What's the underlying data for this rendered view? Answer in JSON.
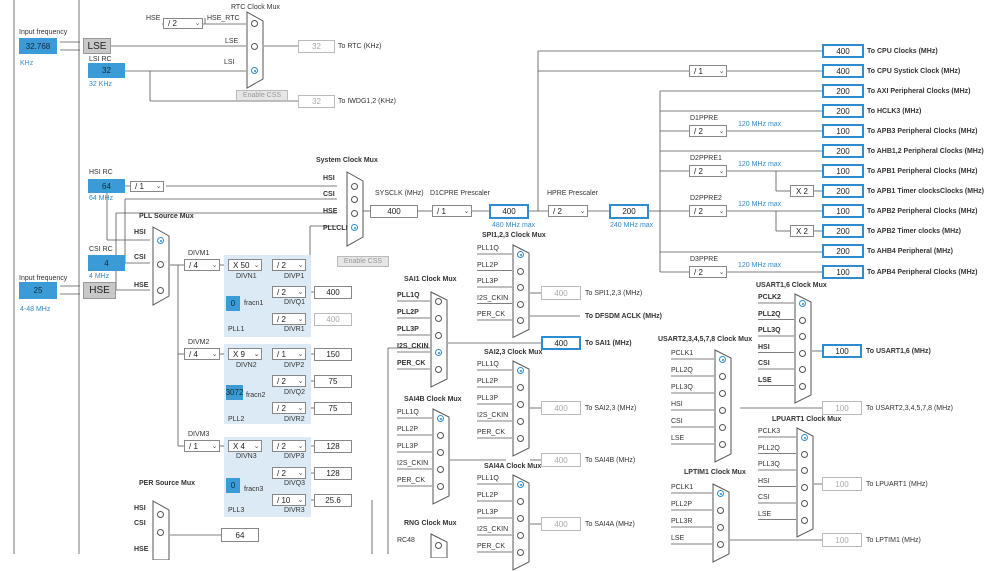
{
  "inputs": {
    "lse_input": {
      "label": "Input frequency",
      "value": "32.768",
      "unit": "KHz"
    },
    "lsi_rc": {
      "label": "LSI RC",
      "value": "32",
      "unit": "32 KHz"
    },
    "hsi_rc": {
      "label": "HSI RC",
      "value": "64",
      "unit": "64 MHz"
    },
    "csi_rc": {
      "label": "CSI RC",
      "value": "4",
      "unit": "4 MHz"
    },
    "hse_input": {
      "label": "Input frequency",
      "value": "25",
      "unit": "4-48 MHz"
    },
    "lse_label": "LSE",
    "hse_label": "HSE"
  },
  "rtc": {
    "mux_title": "RTC Clock Mux",
    "hse_label": "HSE",
    "div_value": "/ 2",
    "hse_rtc_label": "HSE_RTC",
    "lse_label": "LSE",
    "lsi_label": "LSI",
    "rtc_value": "32",
    "rtc_label": "To RTC (KHz)",
    "enable_css": "Enable CSS",
    "iwdg_value": "32",
    "iwdg_label": "To IWDG1,2 (KHz)"
  },
  "sysclk": {
    "mux_title": "System Clock Mux",
    "inputs": [
      "HSI",
      "CSI",
      "HSE",
      "PLLCLK"
    ],
    "sysclk_label": "SYSCLK (MHz)",
    "sysclk_value": "400",
    "d1cpre_label": "D1CPRE Prescaler",
    "d1cpre_value": "/ 1",
    "cpu_value": "400",
    "cpu_max": "480 MHz max",
    "hpre_label": "HPRE Prescaler",
    "hpre_value": "/ 2",
    "axi_value": "200",
    "axi_max": "240 MHz max",
    "enable_css": "Enable CSS"
  },
  "outputs": {
    "systick_div": "/ 1",
    "d1ppre_label": "D1PPRE",
    "d1ppre_value": "/ 2",
    "d1ppre_max": "120 MHz max",
    "d2ppre1_label": "D2PPRE1",
    "d2ppre1_value": "/ 2",
    "d2ppre1_max": "120 MHz max",
    "d2ppre2_label": "D2PPRE2",
    "d2ppre2_value": "/ 2",
    "d2ppre2_max": "120 MHz max",
    "d3ppre_label": "D3PPRE",
    "d3ppre_value": "/ 2",
    "d3ppre_max": "120 MHz max",
    "x2a": "X 2",
    "x2b": "X 2",
    "rows": [
      {
        "value": "400",
        "label": "To CPU Clocks (MHz)"
      },
      {
        "value": "400",
        "label": "To CPU Systick Clock (MHz)"
      },
      {
        "value": "200",
        "label": "To AXI Peripheral Clocks (MHz)"
      },
      {
        "value": "200",
        "label": "To HCLK3 (MHz)"
      },
      {
        "value": "100",
        "label": "To APB3 Peripheral Clocks (MHz)"
      },
      {
        "value": "200",
        "label": "To AHB1,2 Peripheral Clocks (MHz)"
      },
      {
        "value": "100",
        "label": "To APB1 Peripheral Clocks (MHz)"
      },
      {
        "value": "200",
        "label": "To APB1 Timer clocksClocks (MHz)"
      },
      {
        "value": "100",
        "label": "To APB2 Peripheral Clocks (MHz)"
      },
      {
        "value": "200",
        "label": "To APB2 Timer clocks (MHz)"
      },
      {
        "value": "200",
        "label": "To AHB4 Peripheral (MHz)"
      },
      {
        "value": "100",
        "label": "To APB4 Peripheral Clocks (MHz)"
      }
    ]
  },
  "pll": {
    "source_title": "PLL Source Mux",
    "src_hsi": "HSI",
    "src_csi": "CSI",
    "src_hse": "HSE",
    "divm1_label": "DIVM1",
    "divm1_value": "/ 4",
    "divn1_label": "DIVN1",
    "divn1_value": "X 50",
    "divp1_label": "DIVP1",
    "divp1_value": "/ 2",
    "divq1_label": "DIVQ1",
    "divq1_value": "/ 2",
    "q1_out": "400",
    "divr1_label": "DIVR1",
    "divr1_value": "/ 2",
    "r1_out": "400",
    "fracn1_value": "0",
    "fracn1_label": "fracn1",
    "pll1_label": "PLL1",
    "divm2_label": "DIVM2",
    "divm2_value": "/ 4",
    "divn2_label": "DIVN2",
    "divn2_value": "X 9",
    "divp2_label": "DIVP2",
    "divp2_value": "/ 1",
    "p2_out": "150",
    "divq2_label": "DIVQ2",
    "divq2_value": "/ 2",
    "q2_out": "75",
    "divr2_label": "DIVR2",
    "divr2_value": "/ 2",
    "r2_out": "75",
    "fracn2_value": "3072",
    "fracn2_label": "fracn2",
    "pll2_label": "PLL2",
    "divm3_label": "DIVM3",
    "divm3_value": "/ 1",
    "divn3_label": "DIVN3",
    "divn3_value": "X 4",
    "divp3_label": "DIVP3",
    "divp3_value": "/ 2",
    "p3_out": "128",
    "divq3_label": "DIVQ3",
    "divq3_value": "/ 2",
    "q3_out": "128",
    "divr3_label": "DIVR3",
    "divr3_value": "/ 10",
    "r3_out": "25.6",
    "fracn3_value": "0",
    "fracn3_label": "fracn3",
    "pll3_label": "PLL3"
  },
  "per": {
    "title": "PER Source Mux",
    "hsi": "HSI",
    "csi": "CSI",
    "hse": "HSE",
    "value": "64"
  },
  "sai1": {
    "title": "SAI1 Clock Mux",
    "inputs": [
      "PLL1Q",
      "PLL2P",
      "PLL3P",
      "I2S_CKIN",
      "PER_CK"
    ],
    "value": "400",
    "label": "To SAI1 (MHz)"
  },
  "spi123": {
    "title": "SPI1,2,3 Clock Mux",
    "inputs": [
      "PLL1Q",
      "PLL2P",
      "PLL3P",
      "I2S_CKIN",
      "PER_CK"
    ],
    "value": "400",
    "label": "To SPI1,2,3 (MHz)",
    "dfsdm_label": "To DFSDM ACLK (MHz)"
  },
  "sai23": {
    "title": "SAI2,3 Clock Mux",
    "inputs": [
      "PLL1Q",
      "PLL2P",
      "PLL3P",
      "I2S_CKIN",
      "PER_CK"
    ],
    "value": "400",
    "label": "To SAI2,3 (MHz)"
  },
  "sai4b": {
    "title": "SAI4B Clock Mux",
    "inputs": [
      "PLL1Q",
      "PLL2P",
      "PLL3P",
      "I2S_CKIN",
      "PER_CK"
    ],
    "value": "400",
    "label": "To SAI4B (MHz)"
  },
  "sai4a": {
    "title": "SAI4A Clock Mux",
    "inputs": [
      "PLL1Q",
      "PLL2P",
      "PLL3P",
      "I2S_CKIN",
      "PER_CK"
    ],
    "value": "400",
    "label": "To SAI4A (MHz)"
  },
  "rng": {
    "title": "RNG Clock Mux",
    "input0": "RC48"
  },
  "usart16": {
    "title": "USART1,6 Clock Mux",
    "inputs": [
      "PCLK2",
      "PLL2Q",
      "PLL3Q",
      "HSI",
      "CSI",
      "LSE"
    ],
    "value": "100",
    "label": "To USART1,6 (MHz)"
  },
  "usart2": {
    "title": "USART2,3,4,5,7,8 Clock Mux",
    "inputs": [
      "PCLK1",
      "PLL2Q",
      "PLL3Q",
      "HSI",
      "CSI",
      "LSE"
    ],
    "value": "100",
    "label": "To USART2,3,4,5,7,8 (MHz)"
  },
  "lpuart1": {
    "title": "LPUART1 Clock Mux",
    "inputs": [
      "PCLK3",
      "PLL2Q",
      "PLL3Q",
      "HSI",
      "CSI",
      "LSE"
    ],
    "value": "100",
    "label": "To LPUART1 (MHz)"
  },
  "lptim1": {
    "title": "LPTIM1 Clock Mux",
    "inputs": [
      "PCLK1",
      "PLL2P",
      "PLL3R",
      "LSE"
    ],
    "value": "100",
    "label": "To LPTIM1 (MHz)"
  }
}
